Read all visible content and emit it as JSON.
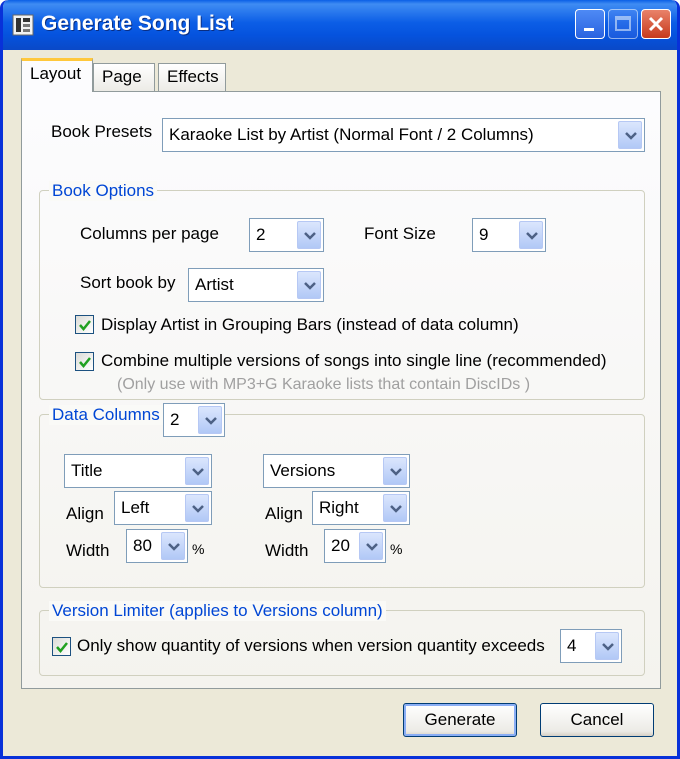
{
  "window": {
    "title": "Generate Song List"
  },
  "tabs": [
    {
      "label": "Layout"
    },
    {
      "label": "Page"
    },
    {
      "label": "Effects"
    }
  ],
  "book_presets": {
    "label": "Book Presets",
    "value": "Karaoke List by Artist (Normal Font / 2 Columns)"
  },
  "book_options": {
    "legend": "Book Options",
    "columns_per_page": {
      "label": "Columns per page",
      "value": "2"
    },
    "font_size": {
      "label": "Font Size",
      "value": "9"
    },
    "sort_book_by": {
      "label": "Sort book by",
      "value": "Artist"
    },
    "display_artist": {
      "label": "Display Artist in Grouping Bars (instead of data column)",
      "checked": true
    },
    "combine_versions": {
      "label": "Combine multiple versions of songs into single line (recommended)",
      "checked": true
    },
    "note": "(Only use with MP3+G Karaoke lists that contain DiscIDs )"
  },
  "data_columns": {
    "legend": "Data Columns",
    "count": "2",
    "columns": [
      {
        "field": "Title",
        "align_label": "Align",
        "align": "Left",
        "width_label": "Width",
        "width": "80",
        "unit": "%"
      },
      {
        "field": "Versions",
        "align_label": "Align",
        "align": "Right",
        "width_label": "Width",
        "width": "20",
        "unit": "%"
      }
    ]
  },
  "version_limiter": {
    "legend": "Version Limiter (applies to Versions column)",
    "label": "Only show quantity of versions when version quantity exceeds",
    "checked": true,
    "value": "4"
  },
  "buttons": {
    "generate": "Generate",
    "cancel": "Cancel"
  },
  "colors": {
    "titlebar": "#0a5fe6",
    "legend_text": "#0046d5",
    "note_text": "#a0a0a0",
    "dialog_bg": "#ece9d8"
  }
}
